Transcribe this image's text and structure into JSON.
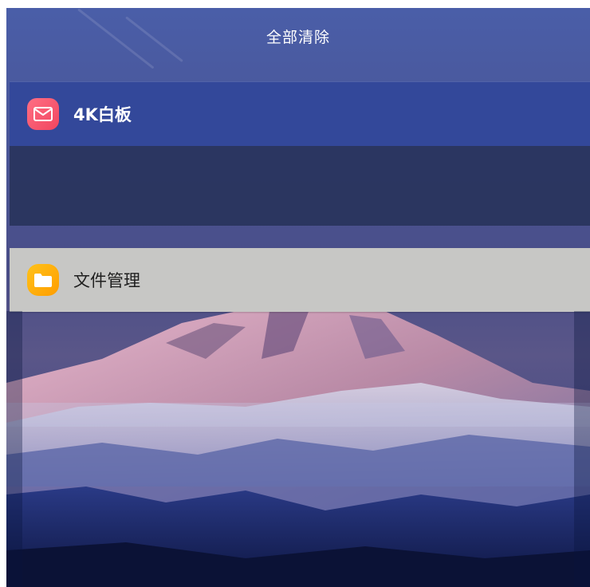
{
  "header": {
    "clear_all_label": "全部清除"
  },
  "recent_apps": [
    {
      "label": "4K白板",
      "icon": "whiteboard-mail-icon",
      "header_color": "#33489a",
      "icon_color": "#f1455f"
    },
    {
      "label": "文件管理",
      "icon": "folder-icon",
      "header_color": "#c7c7c5",
      "icon_color": "#ff9d00"
    }
  ]
}
